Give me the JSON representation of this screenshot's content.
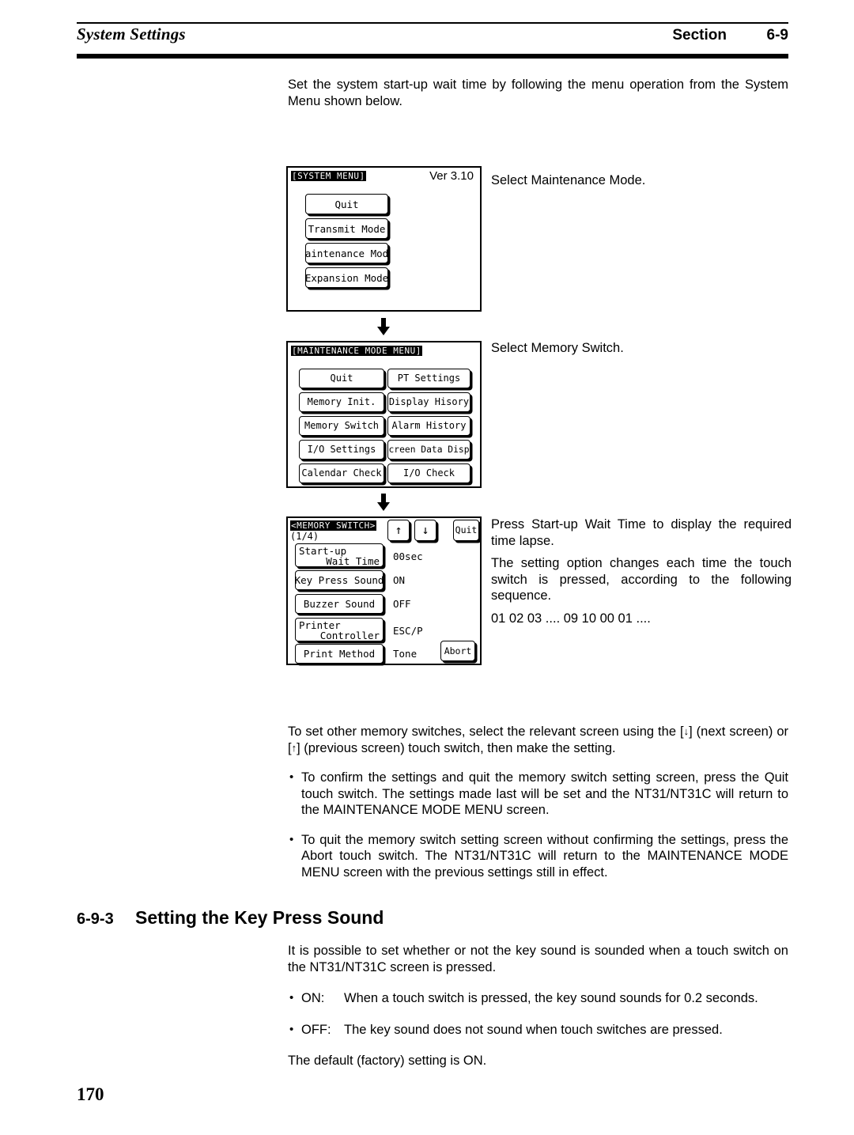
{
  "header": {
    "title": "System Settings",
    "section_label": "Section",
    "section_number": "6-9"
  },
  "intro": {
    "paragraph": "Set the system start-up wait time by following the menu operation from the System Menu shown below."
  },
  "flow": {
    "arrow_glyph": "↓",
    "steps": [
      {
        "caption": "Select Maintenance Mode.",
        "screen": {
          "title": "[SYSTEM MENU]",
          "version": "Ver 3.10",
          "buttons": [
            {
              "label": "Quit"
            },
            {
              "label": "Transmit Mode"
            },
            {
              "label": "Maintenance Mode"
            },
            {
              "label": "Expansion Mode"
            }
          ]
        }
      },
      {
        "caption": "Select Memory Switch.",
        "screen": {
          "title": "[MAINTENANCE MODE MENU]",
          "left_buttons": [
            {
              "label": "Quit"
            },
            {
              "label": "Memory Init."
            },
            {
              "label": "Memory Switch"
            },
            {
              "label": "I/O Settings"
            },
            {
              "label": "Calendar Check"
            }
          ],
          "right_buttons": [
            {
              "label": "PT Settings"
            },
            {
              "label": "Display Hisory"
            },
            {
              "label": "Alarm History"
            },
            {
              "label": "Screen Data Disp."
            },
            {
              "label": "I/O Check"
            }
          ]
        }
      },
      {
        "caption_lines": [
          "Press Start-up Wait Time to display the required time lapse.",
          "The setting option changes each time the touch switch is pressed, according to the following sequence.",
          "01  02  03 .... 09  10  00  01  ...."
        ],
        "screen": {
          "title": "<MEMORY SWITCH>",
          "page_indicator": "(1/4)",
          "up_arrow": "↑",
          "down_arrow": "↓",
          "quit_label": "Quit",
          "abort_label": "Abort",
          "rows": [
            {
              "label_line1": "Start-up",
              "label_line2": "Wait Time",
              "value": "00sec"
            },
            {
              "label_line1": "Key Press Sound",
              "label_line2": "",
              "value": "ON"
            },
            {
              "label_line1": "Buzzer Sound",
              "label_line2": "",
              "value": "OFF"
            },
            {
              "label_line1": "Printer",
              "label_line2": "Controller",
              "value": "ESC/P"
            },
            {
              "label_line1": "Print Method",
              "label_line2": "",
              "value": "Tone"
            }
          ]
        }
      }
    ]
  },
  "notes": {
    "para1_a": "To set other memory switches, select the relevant screen using the [",
    "para1_arrow_down": "↓",
    "para1_b": "] (next screen) or [",
    "para1_arrow_up": "↑",
    "para1_c": "] (previous screen) touch switch, then make the setting.",
    "bullets": [
      "To confirm the settings and quit the memory switch setting screen, press the Quit touch switch. The settings made last will be set and the NT31/NT31C will return to the MAINTENANCE MODE MENU screen.",
      "To quit the memory switch setting screen without confirming the settings, press the Abort touch switch. The NT31/NT31C will return to the MAINTENANCE MODE MENU screen with the previous settings still in effect."
    ]
  },
  "section": {
    "number": "6-9-3",
    "title": "Setting the Key Press Sound",
    "intro": "It is possible to set whether or not the key sound is sounded when a touch switch on the NT31/NT31C screen is pressed.",
    "definitions": [
      {
        "key": "ON:",
        "text": "When a touch switch is pressed, the key sound sounds for 0.2 seconds."
      },
      {
        "key": "OFF:",
        "text": "The key sound does not sound when touch switches are pressed."
      }
    ],
    "default_note": "The default (factory) setting is ON."
  },
  "footer": {
    "page_number": "170"
  }
}
